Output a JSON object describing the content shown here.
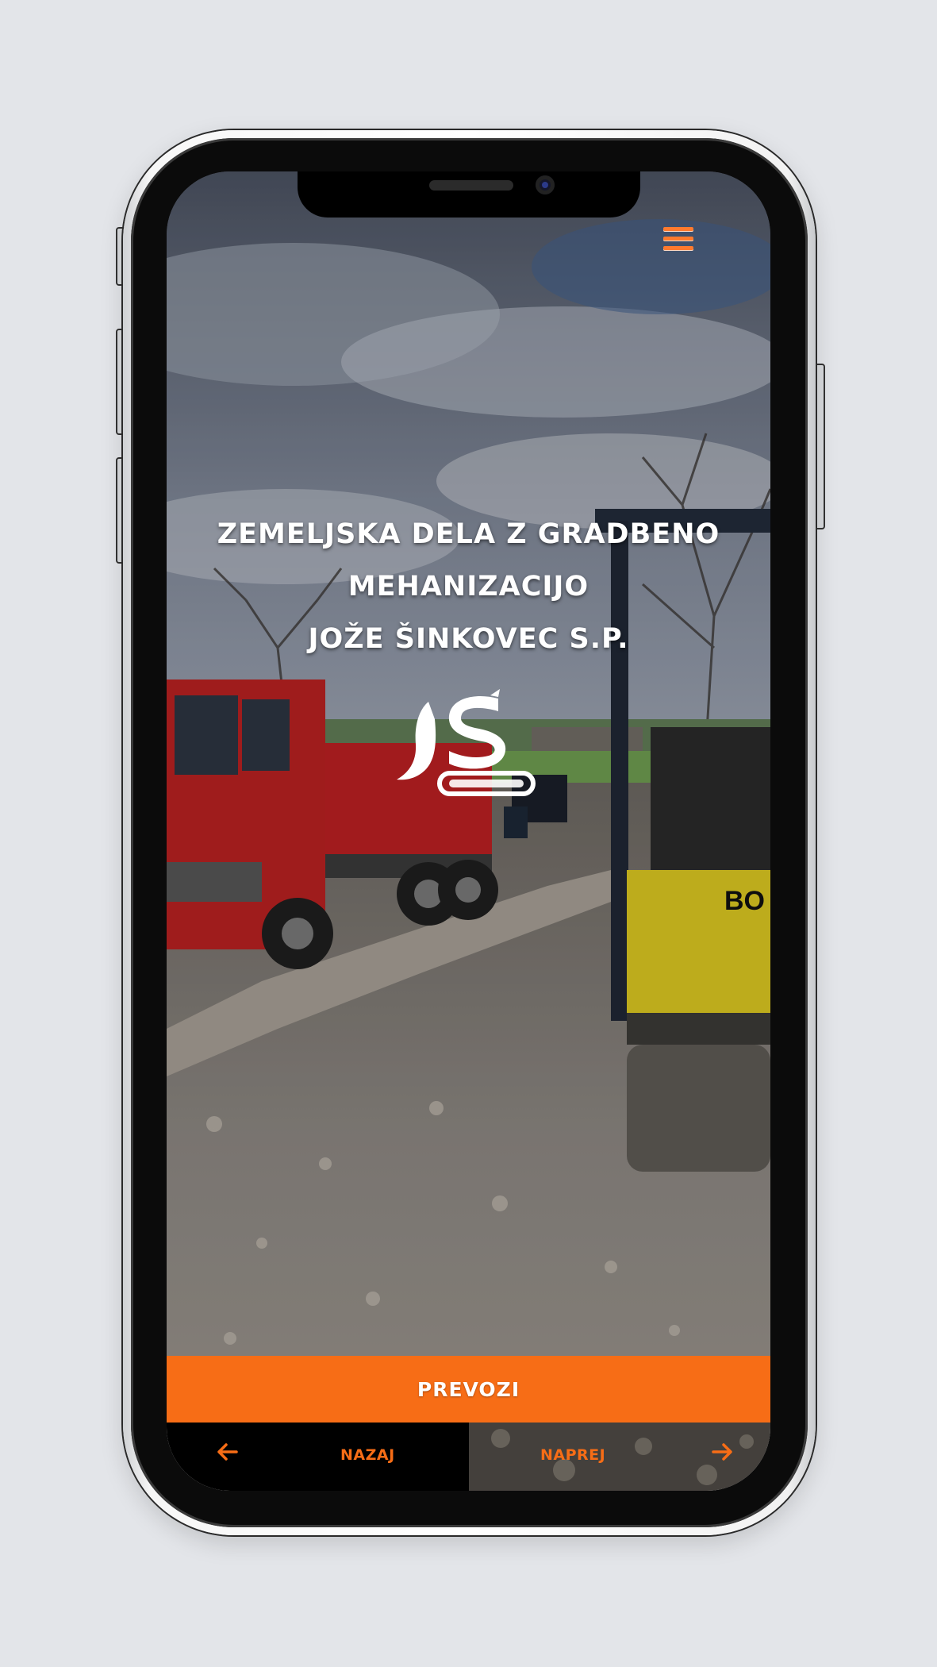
{
  "hero": {
    "title_line1": "ZEMELJSKA DELA Z GRADBENO",
    "title_line2": "MEHANIZACIJO",
    "title_line3": "JOŽE ŠINKOVEC S.P."
  },
  "cta": {
    "label": "PREVOZI"
  },
  "nav": {
    "back_label": "NAZAJ",
    "next_label": "NAPREJ"
  },
  "colors": {
    "accent": "#f76d16",
    "background": "#e3e5e9",
    "nav_back_bg": "#000000"
  },
  "icons": {
    "menu": "hamburger-icon",
    "back": "arrow-left-icon",
    "next": "arrow-right-icon",
    "logo": "excavator-s-logo"
  }
}
